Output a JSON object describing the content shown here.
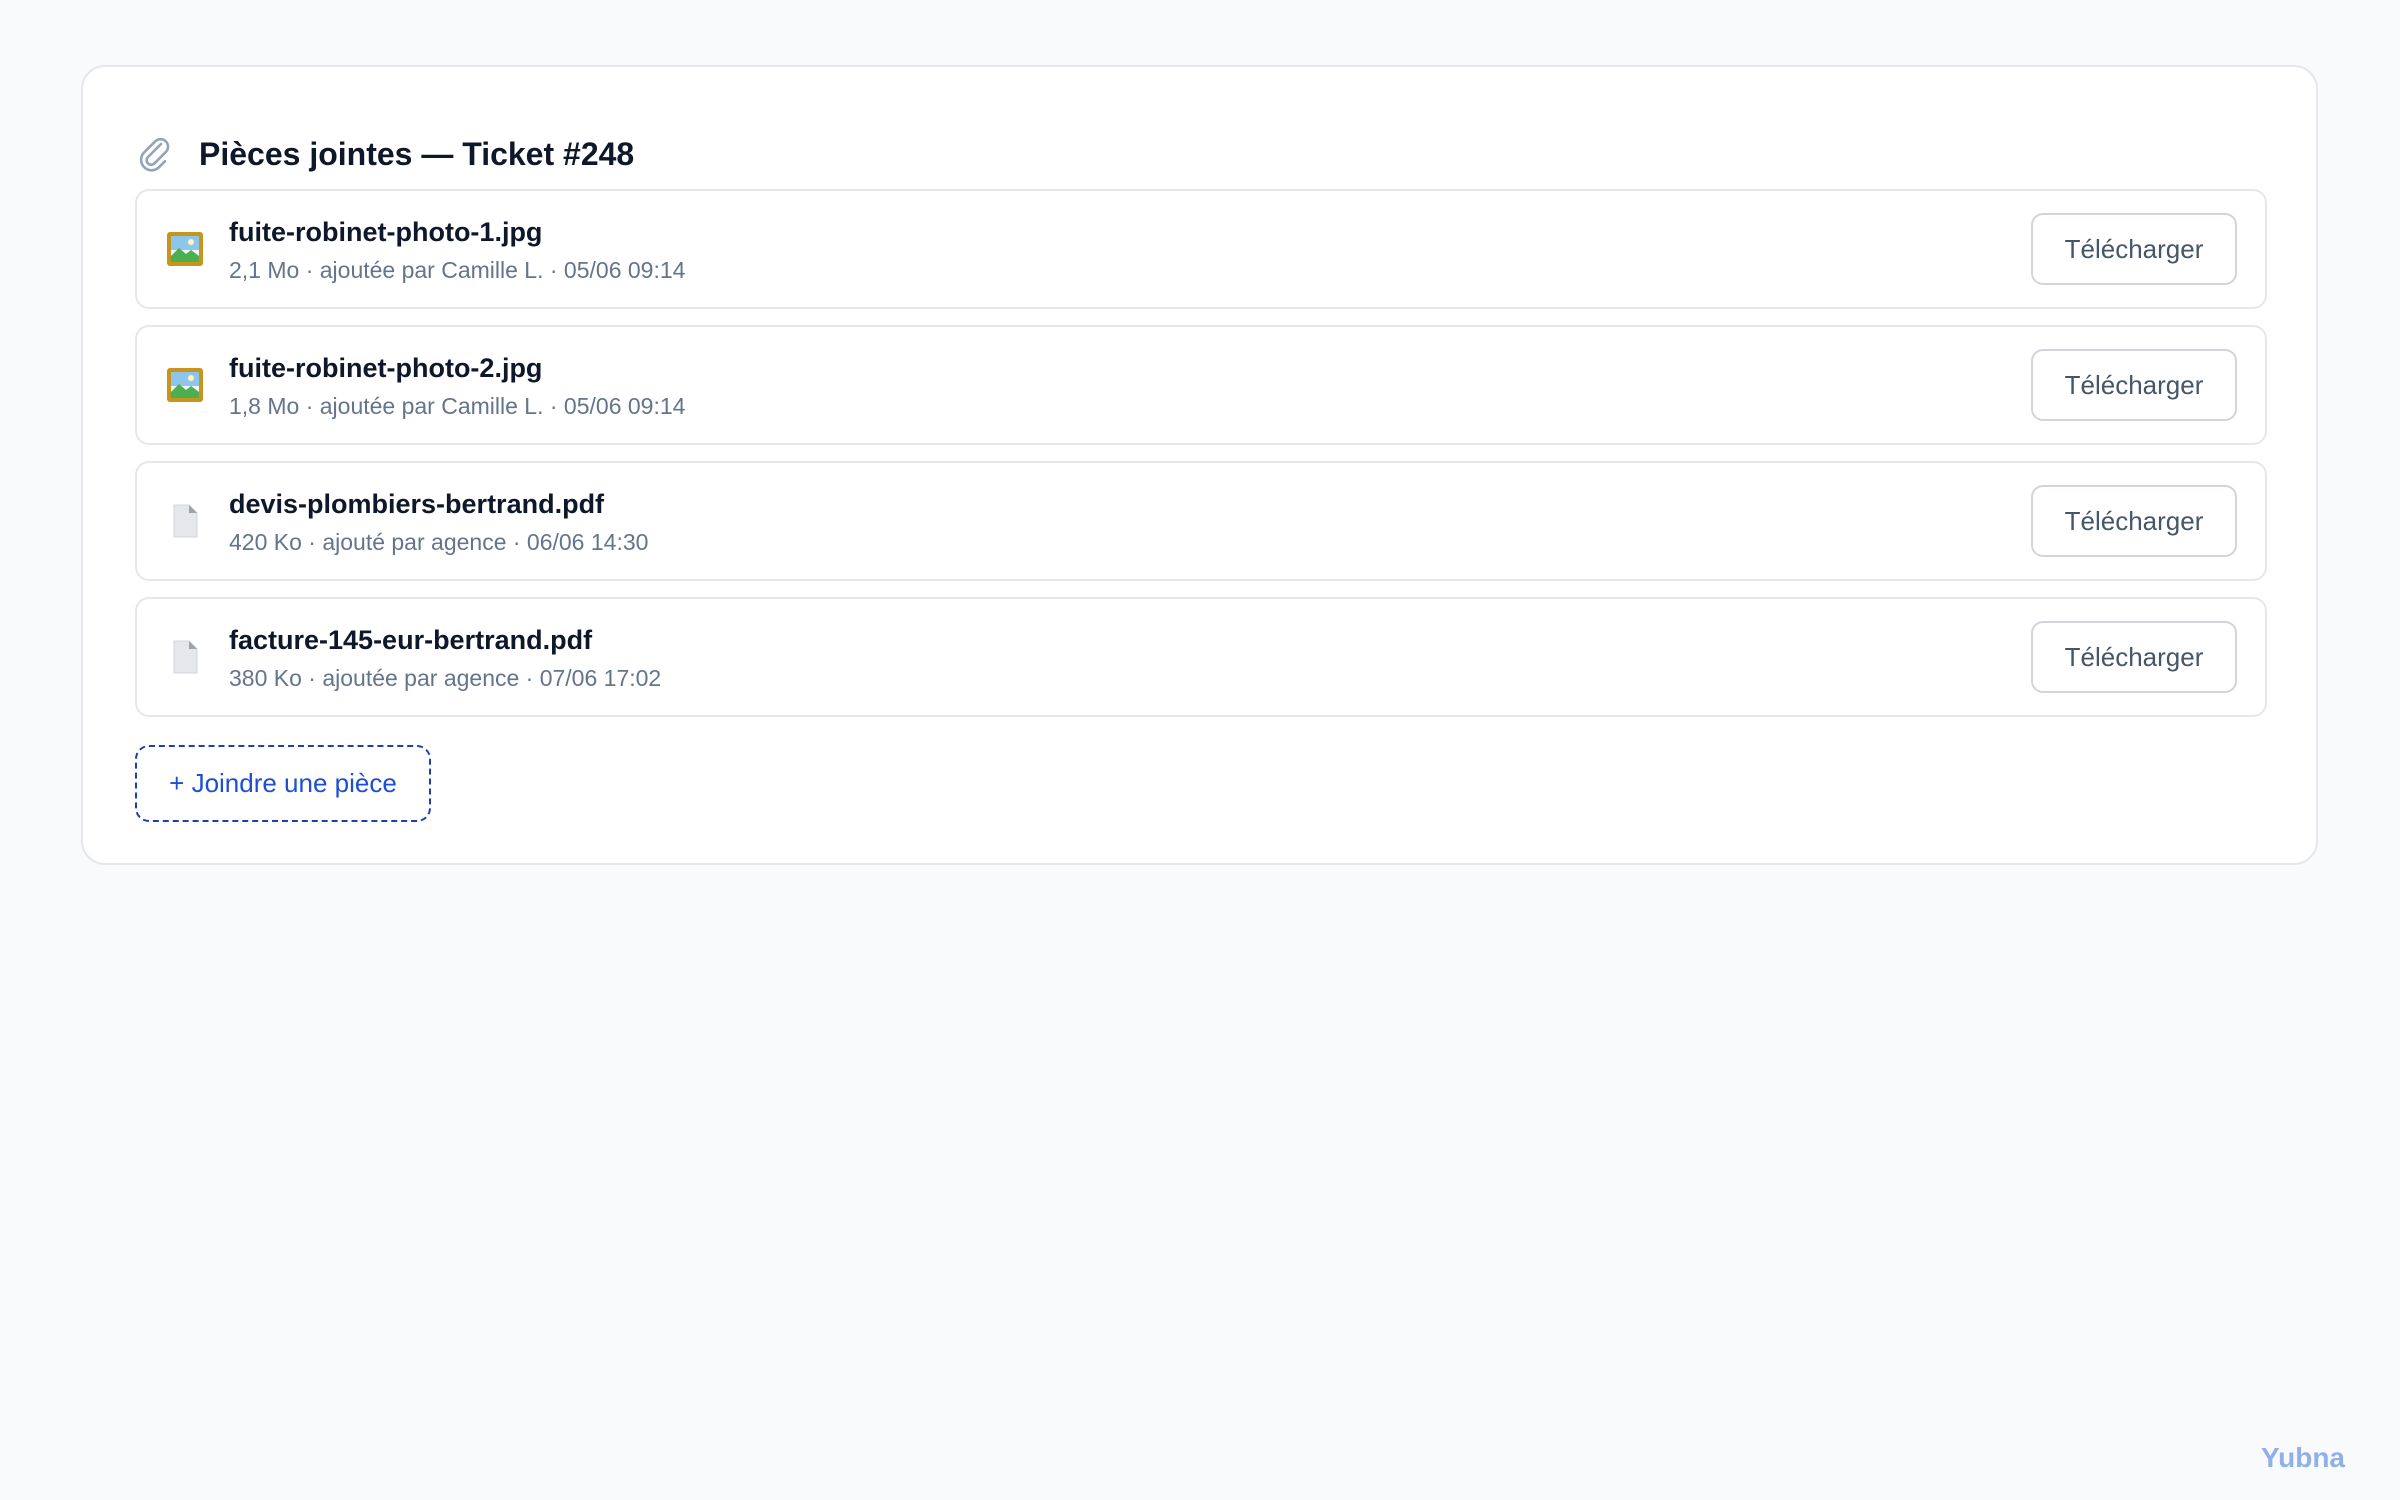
{
  "panel": {
    "title": "Pièces jointes — Ticket #248",
    "title_icon": "paperclip-icon"
  },
  "attachments": [
    {
      "name": "fuite-robinet-photo-1.jpg",
      "meta": "2,1 Mo · ajoutée par Camille L. · 05/06 09:14",
      "icon": "image-icon",
      "download_label": "Télécharger"
    },
    {
      "name": "fuite-robinet-photo-2.jpg",
      "meta": "1,8 Mo · ajoutée par Camille L. · 05/06 09:14",
      "icon": "image-icon",
      "download_label": "Télécharger"
    },
    {
      "name": "devis-plombiers-bertrand.pdf",
      "meta": "420 Ko · ajouté par agence · 06/06 14:30",
      "icon": "document-icon",
      "download_label": "Télécharger"
    },
    {
      "name": "facture-145-eur-bertrand.pdf",
      "meta": "380 Ko · ajoutée par agence · 07/06 17:02",
      "icon": "document-icon",
      "download_label": "Télécharger"
    }
  ],
  "actions": {
    "attach_label": "+ Joindre une pièce"
  },
  "footer": {
    "brand": "Yubna"
  },
  "colors": {
    "accent": "#1d4ed8",
    "brand": "#8fb0e8",
    "muted_text": "#64748b",
    "border": "#e5e7eb"
  }
}
